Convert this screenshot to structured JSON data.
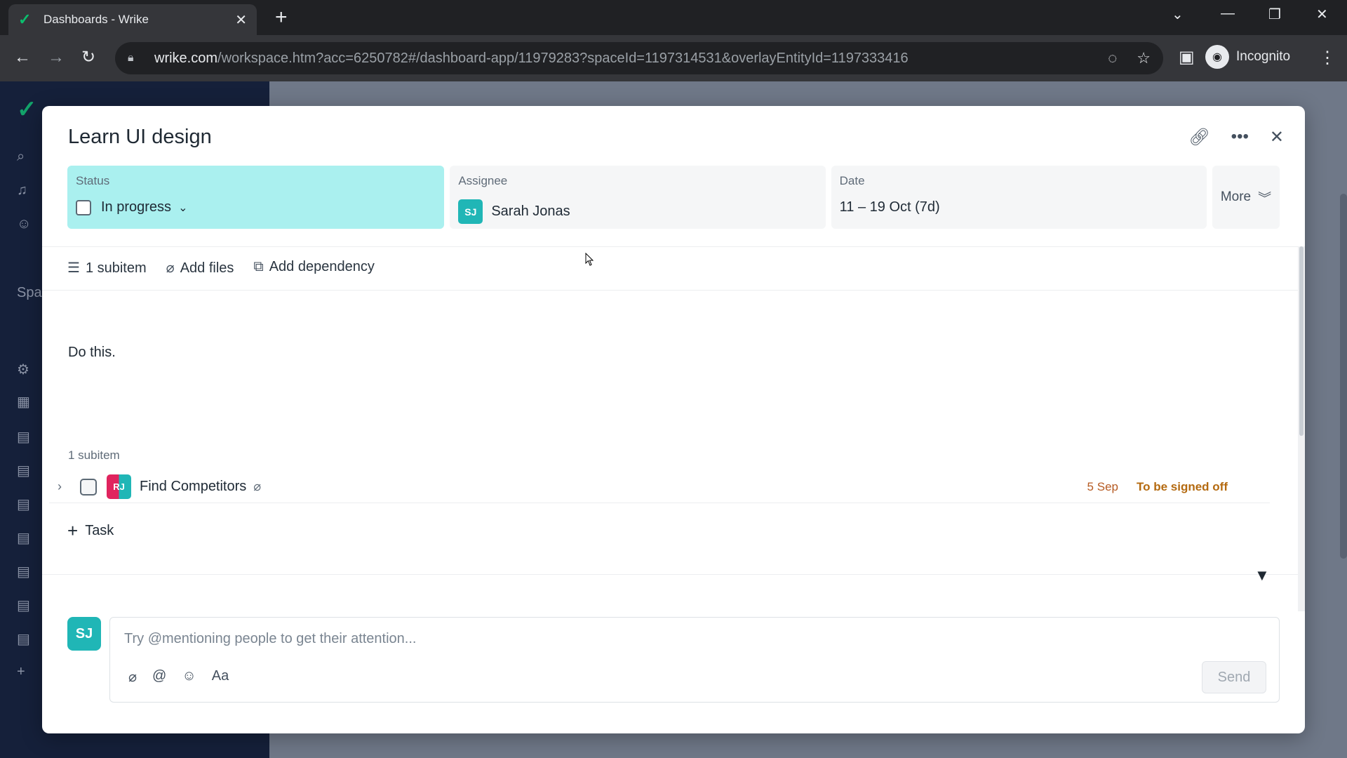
{
  "browser": {
    "tab_title": "Dashboards - Wrike",
    "url_host": "wrike.com",
    "url_path": "/workspace.htm?acc=6250782#/dashboard-app/11979283?spaceId=1197314531&overlayEntityId=1197333416",
    "profile_label": "Incognito"
  },
  "sidebar": {
    "spaces_label": "Spa"
  },
  "task": {
    "title": "Learn UI design",
    "status": {
      "label": "Status",
      "value": "In progress",
      "color": "#aaf0ef"
    },
    "assignee": {
      "label": "Assignee",
      "initials": "SJ",
      "name": "Sarah Jonas"
    },
    "date": {
      "label": "Date",
      "value": "11 – 19 Oct (7d)"
    },
    "more_label": "More",
    "meta": {
      "subitems": "1 subitem",
      "add_files": "Add files",
      "add_dependency": "Add dependency"
    },
    "description": "Do this.",
    "subitems_heading": "1 subitem",
    "subitems": [
      {
        "initials": "RJ",
        "name": "Find Competitors",
        "date": "5 Sep",
        "status": "To be signed off"
      }
    ],
    "add_task_label": "Task"
  },
  "comment": {
    "avatar_initials": "SJ",
    "placeholder": "Try @mentioning people to get their attention...",
    "format_label": "Aa",
    "send_label": "Send"
  }
}
